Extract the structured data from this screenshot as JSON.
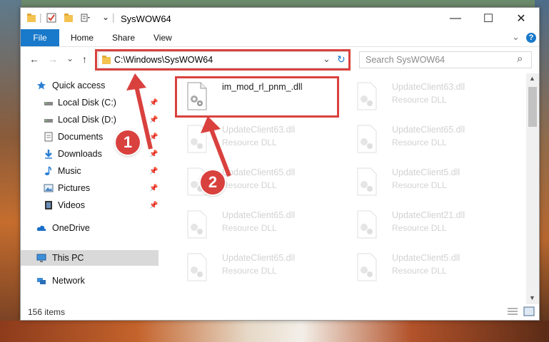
{
  "window": {
    "title": "SysWOW64",
    "quick_access_toolbar": [
      "folder-icon",
      "properties-icon",
      "new-folder-icon",
      "customize-icon"
    ],
    "controls": {
      "minimize": "—",
      "maximize": "☐",
      "close": "✕"
    }
  },
  "ribbon": {
    "tabs": [
      "File",
      "Home",
      "Share",
      "View"
    ],
    "expand_glyph": "⌄",
    "help_glyph": "?"
  },
  "address": {
    "back": "←",
    "forward": "→",
    "recent": "⌄",
    "up": "↑",
    "path": "C:\\Windows\\SysWOW64",
    "dropdown": "⌄",
    "refresh": "↻",
    "search_placeholder": "Search SysWOW64",
    "search_icon": "⌕"
  },
  "nav": {
    "items": [
      {
        "label": "Quick access",
        "icon": "star-icon",
        "pinned": false
      },
      {
        "label": "Local Disk (C:)",
        "icon": "drive-icon",
        "pinned": true
      },
      {
        "label": "Local Disk (D:)",
        "icon": "drive-icon",
        "pinned": true
      },
      {
        "label": "Documents",
        "icon": "documents-icon",
        "pinned": true
      },
      {
        "label": "Downloads",
        "icon": "downloads-icon",
        "pinned": true
      },
      {
        "label": "Music",
        "icon": "music-icon",
        "pinned": true
      },
      {
        "label": "Pictures",
        "icon": "pictures-icon",
        "pinned": true
      },
      {
        "label": "Videos",
        "icon": "videos-icon",
        "pinned": true
      },
      {
        "label": "OneDrive",
        "icon": "cloud-icon",
        "pinned": false
      },
      {
        "label": "This PC",
        "icon": "computer-icon",
        "pinned": false,
        "selected": true
      },
      {
        "label": "Network",
        "icon": "network-icon",
        "pinned": false
      }
    ],
    "pin_glyph": "📌"
  },
  "files": [
    {
      "name": "im_mod_rl_pnm_.dll",
      "type": "",
      "faded": false
    },
    {
      "name": "UpdateClient63.dll",
      "type": "Resource DLL",
      "faded": true
    },
    {
      "name": "UpdateClient63.dll",
      "type": "Resource DLL",
      "faded": true
    },
    {
      "name": "UpdateClient65.dll",
      "type": "Resource DLL",
      "faded": true
    },
    {
      "name": "UpdateClient65.dll",
      "type": "Resource DLL",
      "faded": true
    },
    {
      "name": "UpdateClient5.dll",
      "type": "Resource DLL",
      "faded": true
    },
    {
      "name": "UpdateClient65.dll",
      "type": "Resource DLL",
      "faded": true
    },
    {
      "name": "UpdateClient21.dll",
      "type": "Resource DLL",
      "faded": true
    },
    {
      "name": "UpdateClient65.dll",
      "type": "Resource DLL",
      "faded": true
    },
    {
      "name": "UpdateClient5.dll",
      "type": "Resource DLL",
      "faded": true
    }
  ],
  "status": {
    "item_count": "156 items"
  },
  "annotations": {
    "step1": "1",
    "step2": "2",
    "color": "#d9413e"
  }
}
